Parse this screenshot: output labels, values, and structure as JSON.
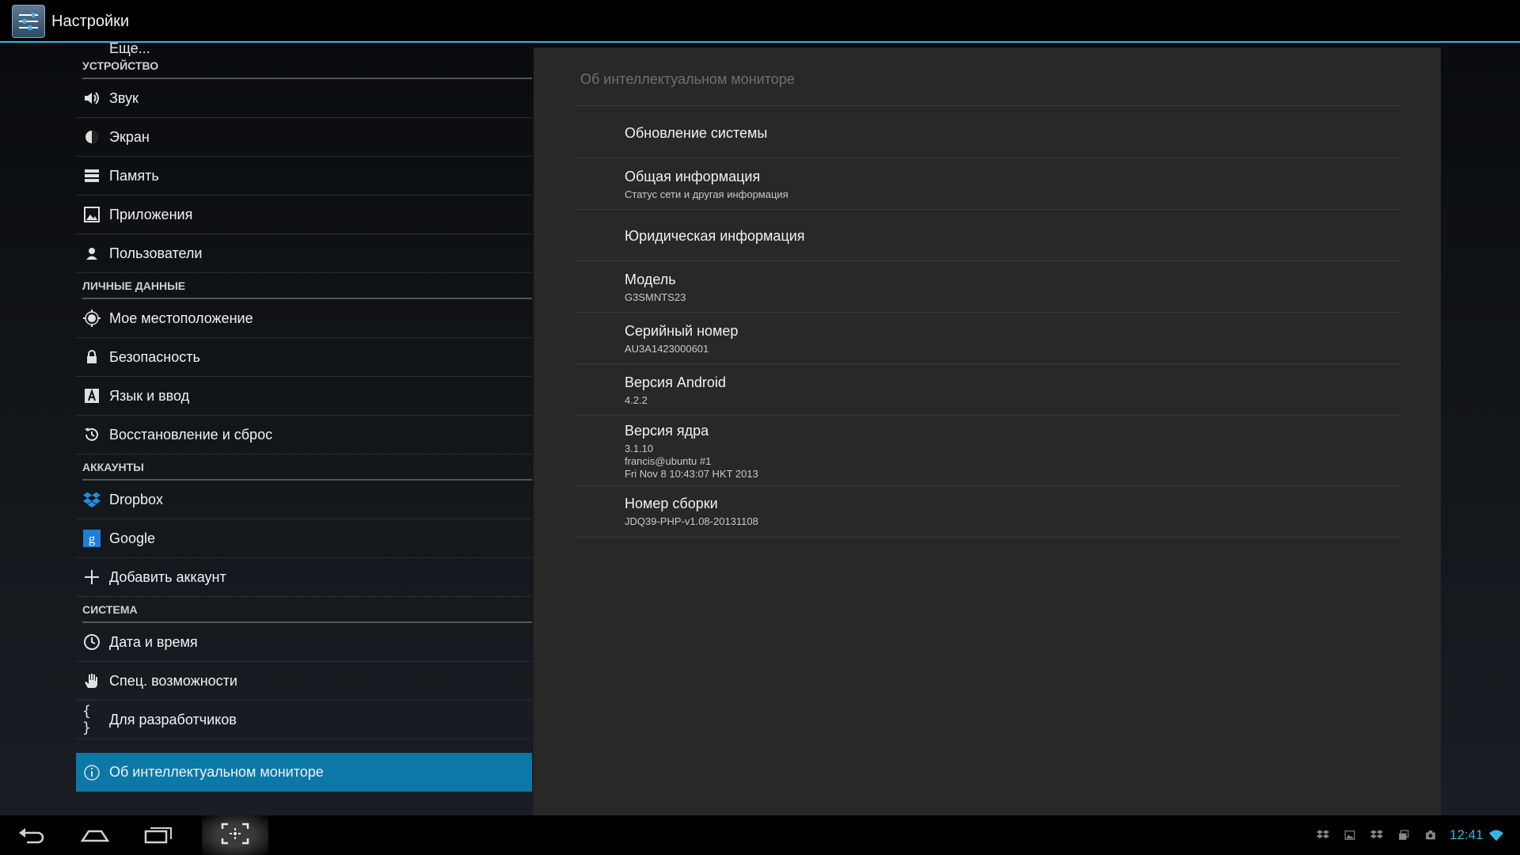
{
  "action_bar": {
    "title": "Настройки",
    "icon": "settings-sliders-icon"
  },
  "sidebar": {
    "more_label": "Еще...",
    "sections": [
      {
        "header": "УСТРОЙСТВО",
        "items": [
          {
            "label": "Звук",
            "icon": "sound-icon"
          },
          {
            "label": "Экран",
            "icon": "brightness-icon"
          },
          {
            "label": "Память",
            "icon": "storage-icon"
          },
          {
            "label": "Приложения",
            "icon": "apps-icon"
          },
          {
            "label": "Пользователи",
            "icon": "user-icon"
          }
        ]
      },
      {
        "header": "ЛИЧНЫЕ ДАННЫЕ",
        "items": [
          {
            "label": "Мое местоположение",
            "icon": "location-icon"
          },
          {
            "label": "Безопасность",
            "icon": "lock-icon"
          },
          {
            "label": "Язык и ввод",
            "icon": "keyboard-icon"
          },
          {
            "label": "Восстановление и сброс",
            "icon": "restore-icon"
          }
        ]
      },
      {
        "header": "АККАУНТЫ",
        "items": [
          {
            "label": "Dropbox",
            "icon": "dropbox-icon"
          },
          {
            "label": "Google",
            "icon": "google-icon"
          },
          {
            "label": "Добавить аккаунт",
            "icon": "plus-icon"
          }
        ]
      },
      {
        "header": "СИСТЕМА",
        "items": [
          {
            "label": "Дата и время",
            "icon": "clock-icon"
          },
          {
            "label": "Спец. возможности",
            "icon": "hand-icon"
          },
          {
            "label": "Для разработчиков",
            "icon": "braces-icon"
          },
          {
            "label": "Об интеллектуальном мониторе",
            "icon": "info-icon",
            "active": true
          }
        ]
      }
    ]
  },
  "detail": {
    "title": "Об интеллектуальном мониторе",
    "items": [
      {
        "title": "Обновление системы",
        "summary": []
      },
      {
        "title": "Общая информация",
        "summary": [
          "Статус сети и другая информация"
        ]
      },
      {
        "title": "Юридическая информация",
        "summary": []
      },
      {
        "title": "Модель",
        "summary": [
          "G3SMNTS23"
        ]
      },
      {
        "title": "Серийный номер",
        "summary": [
          "AU3A1423000601"
        ]
      },
      {
        "title": "Версия Android",
        "summary": [
          "4.2.2"
        ]
      },
      {
        "title": "Версия ядра",
        "summary": [
          "3.1.10",
          "francis@ubuntu #1",
          "Fri Nov 8 10:43:07 HKT 2013"
        ]
      },
      {
        "title": "Номер сборки",
        "summary": [
          "JDQ39-PHP-v1.08-20131108"
        ]
      }
    ]
  },
  "nav_bar": {
    "buttons": [
      "back-icon",
      "home-icon",
      "recents-icon",
      "screenshot-icon"
    ]
  },
  "status_bar": {
    "time": "12:41",
    "icons": [
      "dropbox-icon",
      "image-icon",
      "dropbox-icon",
      "photos-icon",
      "camera-icon",
      "wifi-icon"
    ],
    "accent_color": "#33b5e5"
  }
}
